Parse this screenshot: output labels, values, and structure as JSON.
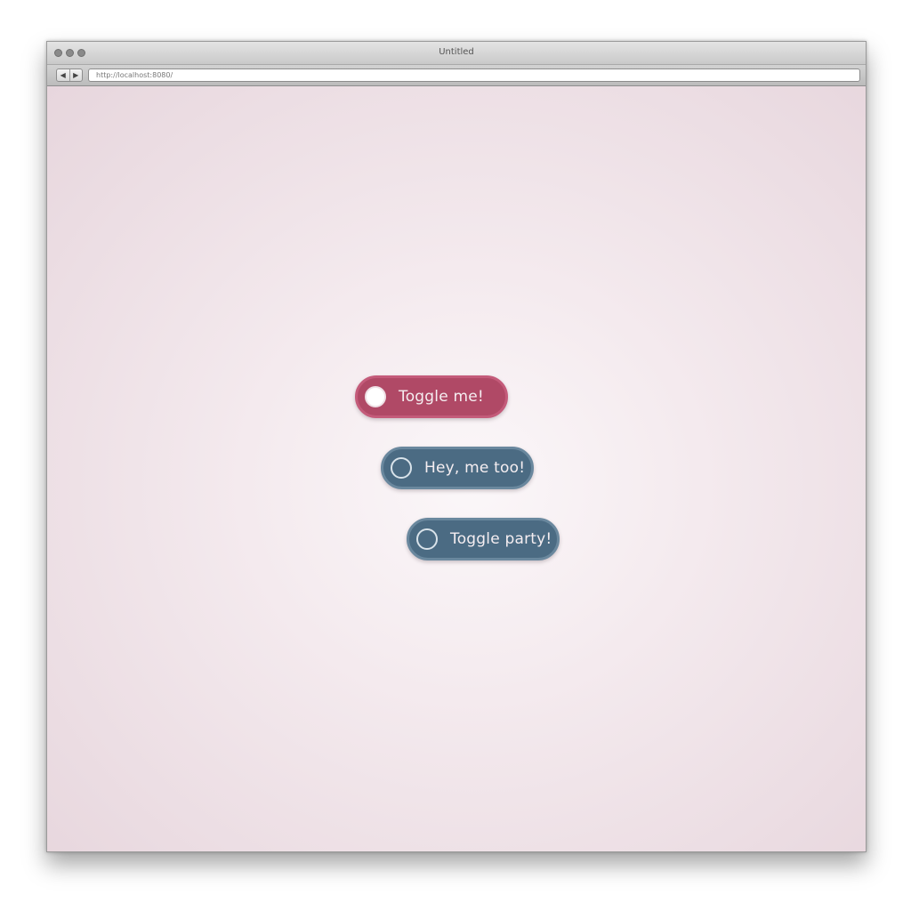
{
  "window": {
    "title": "Untitled",
    "address": "http://localhost:8080/"
  },
  "toolbar": {
    "back_label": "◀",
    "forward_label": "▶"
  },
  "toggles": [
    {
      "label": "Toggle me!",
      "state": "on"
    },
    {
      "label": "Hey, me too!",
      "state": "off"
    },
    {
      "label": "Toggle party!",
      "state": "off"
    }
  ],
  "colors": {
    "toggle_on": "#b04966",
    "toggle_off": "#4b6b83",
    "background": "#f4eaee"
  },
  "icons": {
    "knob": "circle-knob-icon"
  }
}
